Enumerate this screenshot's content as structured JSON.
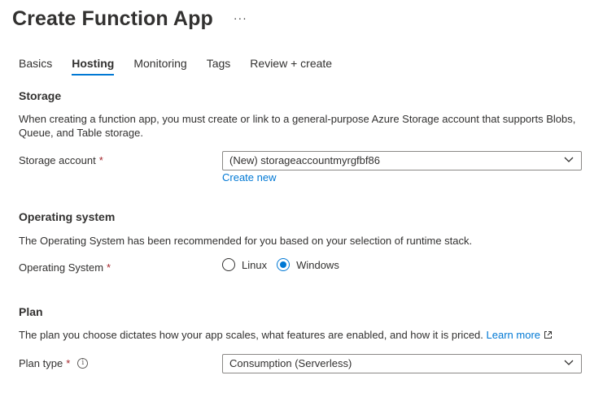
{
  "header": {
    "title": "Create Function App",
    "more_label": "···"
  },
  "tabs": [
    {
      "label": "Basics",
      "active": false
    },
    {
      "label": "Hosting",
      "active": true
    },
    {
      "label": "Monitoring",
      "active": false
    },
    {
      "label": "Tags",
      "active": false
    },
    {
      "label": "Review + create",
      "active": false
    }
  ],
  "storage": {
    "heading": "Storage",
    "description": "When creating a function app, you must create or link to a general-purpose Azure Storage account that supports Blobs, Queue, and Table storage.",
    "account_label": "Storage account",
    "required_mark": "*",
    "account_value": "(New) storageaccountmyrgfbf86",
    "create_new_link": "Create new"
  },
  "os": {
    "heading": "Operating system",
    "description": "The Operating System has been recommended for you based on your selection of runtime stack.",
    "label": "Operating System",
    "required_mark": "*",
    "options": [
      {
        "label": "Linux",
        "checked": false
      },
      {
        "label": "Windows",
        "checked": true
      }
    ]
  },
  "plan": {
    "heading": "Plan",
    "description": "The plan you choose dictates how your app scales, what features are enabled, and how it is priced.",
    "learn_more_link": "Learn more",
    "type_label": "Plan type",
    "required_mark": "*",
    "type_value": "Consumption (Serverless)"
  },
  "colors": {
    "accent": "#0078d4",
    "text": "#323130",
    "required": "#a4262c",
    "border": "#8a8886"
  }
}
